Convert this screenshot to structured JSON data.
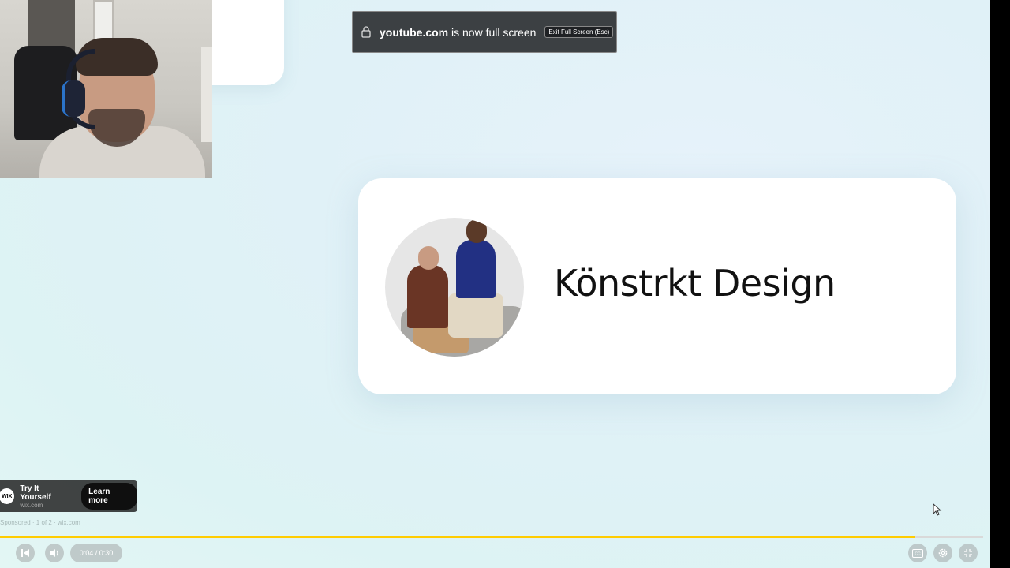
{
  "notification": {
    "domain": "youtube.com",
    "message": " is now full screen",
    "exit_label": "Exit Full Screen (Esc)"
  },
  "brand_card": {
    "name": "Könstrkt Design"
  },
  "ad": {
    "logo_text": "WIX",
    "title": "Try It Yourself",
    "domain": "wix.com",
    "cta": "Learn more",
    "sponsored_text": "Sponsored · 1 of 2 · wix.com"
  },
  "player": {
    "time_display": "0:04 / 0:30",
    "progress": 0.93,
    "progress_color": "#ffcc00"
  },
  "icons": [
    "lock-icon",
    "previous-icon",
    "volume-icon",
    "captions-icon",
    "settings-icon",
    "exit-fullscreen-icon",
    "mouse-cursor-icon"
  ]
}
